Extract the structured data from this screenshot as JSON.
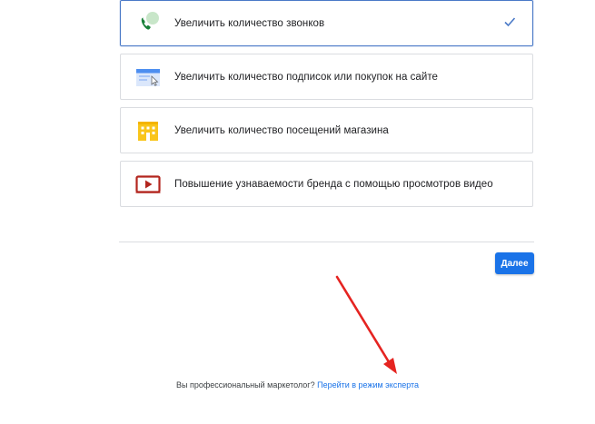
{
  "goals": [
    {
      "label": "Увеличить количество звонков",
      "icon": "phone-call-icon",
      "selected": true
    },
    {
      "label": "Увеличить количество подписок или покупок на сайте",
      "icon": "website-click-icon",
      "selected": false
    },
    {
      "label": "Увеличить количество посещений магазина",
      "icon": "store-building-icon",
      "selected": false
    },
    {
      "label": "Повышение узнаваемости бренда с помощью просмотров видео",
      "icon": "video-play-icon",
      "selected": false
    }
  ],
  "next_button": {
    "label": "Далее"
  },
  "expert_mode": {
    "question": "Вы профессиональный маркетолог?",
    "link_label": "Перейти в режим эксперта"
  },
  "colors": {
    "primary": "#1a73e8",
    "selected_border": "#4a79c7",
    "phone_green": "#188038",
    "store_yellow": "#f9c51b",
    "video_red": "#b3261e",
    "annotation_arrow": "#e52421"
  }
}
